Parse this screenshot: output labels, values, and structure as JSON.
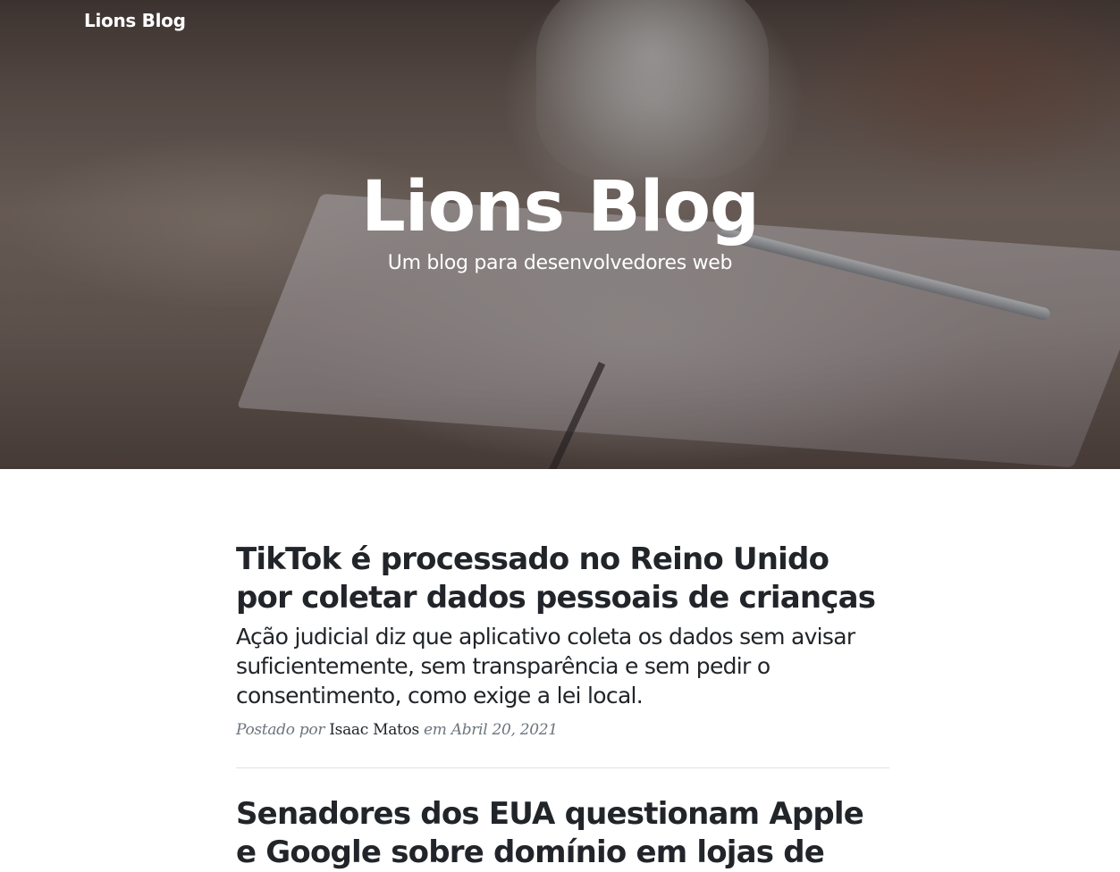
{
  "navbar": {
    "brand": "Lions Blog"
  },
  "header": {
    "title": "Lions Blog",
    "subheading": "Um blog para desenvolvedores web"
  },
  "posts": [
    {
      "title": "TikTok é processado no Reino Unido por coletar dados pessoais de crianças",
      "subtitle": "Ação judicial diz que aplicativo coleta os dados sem avisar suficientemente, sem transparência e sem pedir o consentimento, como exige a lei local.",
      "meta_prefix": "Postado por",
      "author": "Isaac Matos",
      "meta_date": "em Abril 20, 2021"
    },
    {
      "title": "Senadores dos EUA questionam Apple e Google sobre domínio em lojas de"
    }
  ]
}
